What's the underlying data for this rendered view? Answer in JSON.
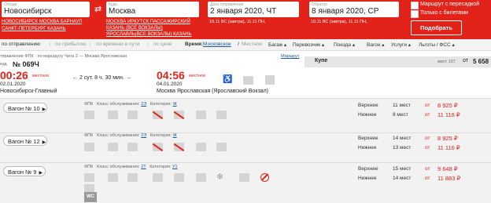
{
  "search": {
    "from_label": "Откуда",
    "from_value": "Новосибирск",
    "from_hints_line1": [
      "НОВОСИБИРСК",
      "МОСКВА",
      "БАРНАУЛ"
    ],
    "from_hints_line2": [
      "САНКТ-ПЕТЕРБУРГ",
      "КАЗАНЬ"
    ],
    "to_label": "Куда",
    "to_value": "Москва",
    "to_hints_line1": [
      "МОСКВА",
      "ИРКУТСК ПАССАЖИРСКИЙ"
    ],
    "to_hints_line2": [
      "КАЗАНЬ (ВСЕ ВОКЗАЛЫ)"
    ],
    "to_hints_line3": [
      "ЯРОСЛАВЛЬ(ВСЕ ВОКЗАЛЫ)",
      "КАЗАНЬ"
    ],
    "depart_label": "Дата отправления",
    "depart_value": "2 января 2020, ЧТ",
    "depart_hint": "10.11 ВС (завтра), 11.11 ПН,",
    "return_label": "Обратно",
    "return_value": "8 января 2020, СР",
    "return_hint": "10.11 ВС (завтра), 11.11 ПН,",
    "transfer_label": "Маршрут с пересадкой",
    "tickets_only_label": "Только с билетами",
    "find_button": "Подобрать",
    "swap_icon": "swap-arrows-icon"
  },
  "filters": {
    "by_departure": "по отправлению",
    "by_arrival": "по прибытию",
    "by_travel_time": "по времени в пути",
    "by_price": "по цене",
    "time_label": "Время:",
    "time_moscow": "Московское",
    "time_sep": "/",
    "time_local": "Местное",
    "baggage": "Багаж",
    "carrier": "Перевозчик",
    "train": "Поезда",
    "wagon": "Вагон",
    "services": "Услуги",
    "benefits": "Льготы / ФСС"
  },
  "train": {
    "route_note": "тправление ФПК · по маршруту Чита 2 — Москва Ярославская",
    "route_link": "Маршрут",
    "number_prefix": "езд",
    "number": "№ 069Ч",
    "dep_time": "00:26",
    "dep_time_note": "местное",
    "dep_date": "02.01.2020",
    "dep_station": "Новосибирск-Главный",
    "duration": "2 сут. 8 ч. 30 мин.",
    "arr_time": "04:56",
    "arr_time_note": "местное",
    "arr_date": "04.01.2020",
    "arr_station": "Москва Ярославская (Ярославский Вокзал)",
    "class_header": "Купе",
    "seats_header": "мест 107",
    "price_from": "от",
    "price_header": "5 658"
  },
  "wagons": [
    {
      "button": "Вагон № 10",
      "carrier": "ФПК",
      "class_label": "Класс обслуживания:",
      "class_value": "2Э",
      "category_label": "Категория:",
      "category_value": "Ж",
      "rows": [
        {
          "label": "Верхнее",
          "count": "11 мест",
          "from": "от",
          "price": "8 925 ₽"
        },
        {
          "label": "Нижнее",
          "count": "8 мест",
          "from": "от",
          "price": "11 116 ₽"
        }
      ]
    },
    {
      "button": "Вагон № 12",
      "carrier": "ФПК",
      "class_label": "Класс обслуживания:",
      "class_value": "2Э",
      "category_label": "Категория:",
      "category_value": "Ж",
      "rows": [
        {
          "label": "Верхнее",
          "count": "14 мест",
          "from": "от",
          "price": "8 925 ₽"
        },
        {
          "label": "Нижнее",
          "count": "13 мест",
          "from": "от",
          "price": "11 116 ₽"
        }
      ]
    },
    {
      "button": "Вагон № 9",
      "carrier": "ФПК",
      "class_label": "Класс обслуживания:",
      "class_value": "2Т",
      "category_label": "Категория:",
      "category_value": "У1",
      "wc_label": "WC",
      "rows": [
        {
          "label": "Верхнее",
          "count": "15 мест",
          "from": "от",
          "price": "9 648 ₽"
        },
        {
          "label": "Нижнее",
          "count": "14 мест",
          "from": "от",
          "price": "11 883 ₽"
        }
      ]
    }
  ],
  "colors": {
    "brand": "#e2231a",
    "link": "#1a5aa0"
  }
}
